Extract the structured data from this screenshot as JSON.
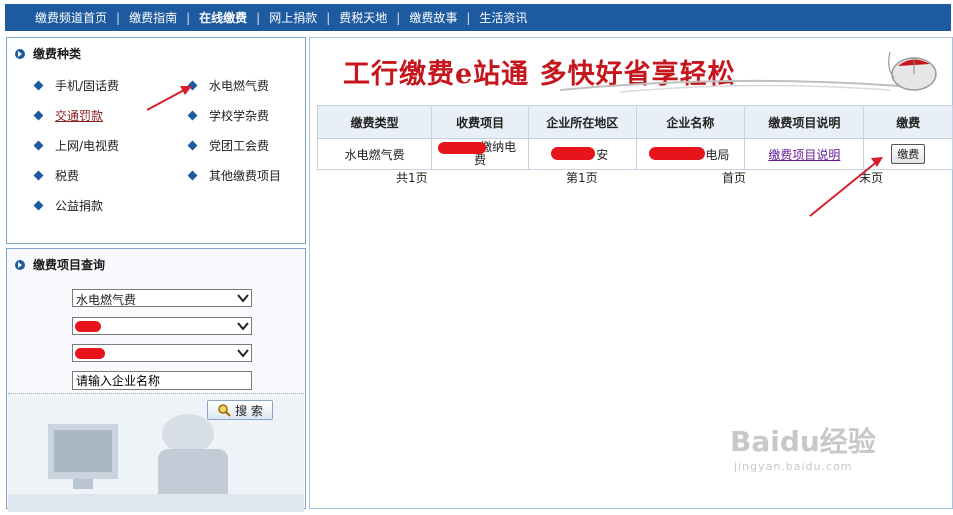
{
  "nav": {
    "items": [
      {
        "label": "缴费频道首页",
        "active": false
      },
      {
        "label": "缴费指南",
        "active": false
      },
      {
        "label": "在线缴费",
        "active": true
      },
      {
        "label": "网上捐款",
        "active": false
      },
      {
        "label": "费税天地",
        "active": false
      },
      {
        "label": "缴费故事",
        "active": false
      },
      {
        "label": "生活资讯",
        "active": false
      }
    ]
  },
  "categories": {
    "title": "缴费种类",
    "items": [
      "手机/固话费",
      "水电燃气费",
      "交通罚款",
      "学校学杂费",
      "上网/电视费",
      "党团工会费",
      "税费",
      "其他缴费项目",
      "公益捐款"
    ]
  },
  "query": {
    "title": "缴费项目查询",
    "select1": "水电燃气费",
    "select2": "",
    "select3": "",
    "company_placeholder": "请输入企业名称",
    "search_label": "搜 索"
  },
  "banner": {
    "text": "工行缴费e站通 多快好省享轻松"
  },
  "table": {
    "headers": [
      "缴费类型",
      "收费项目",
      "企业所在地区",
      "企业名称",
      "缴费项目说明",
      "缴费"
    ],
    "row": {
      "type": "水电燃气费",
      "item_a": "",
      "item_b": "缴纳电",
      "item_c": "费",
      "region": "安",
      "company": "电局",
      "desc_link": "缴费项目说明",
      "pay_button": "缴费"
    }
  },
  "pager": {
    "total": "共1页",
    "current": "第1页",
    "first": "首页",
    "last": "末页"
  },
  "watermark": {
    "brand": "Baidu经验",
    "url": "jingyan.baidu.com"
  },
  "colors": {
    "nav_bg": "#1d5aa0",
    "banner_red": "#c4161c",
    "redaction": "#e8141c",
    "annotation_arrow": "#d81e2a"
  }
}
